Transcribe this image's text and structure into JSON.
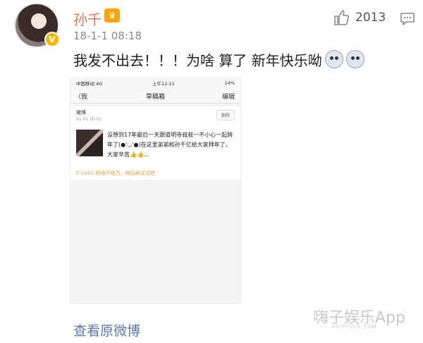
{
  "post": {
    "username": "孙千",
    "vip_label": "♛",
    "verified_badge": "V",
    "time": "18-1-1 08:18",
    "like_count": "2013",
    "text": "我发不出去！！！为啥 算了 新年快乐呦",
    "emoji_names": [
      "husky-emoji",
      "husky-emoji"
    ],
    "view_original": "查看原微博"
  },
  "screenshot": {
    "carrier": "中国移动  4G",
    "clock": "上午12:11",
    "battery": "14%",
    "back_label": "〈我",
    "title": "草稿箱",
    "edit_label": "编辑",
    "draft": {
      "source": "微博",
      "date": "01-01 00:01",
      "delete_label": "删除",
      "text": "没想到17年最后一天跟道明寺叔叔一不小心一起跨年了(●'◡'●)在这里弟弟和孙千亿给大家拜年了，大家辛苦👍👍...",
      "error": "C-1001 网络不给力，稍后再试试吧"
    }
  },
  "watermark": {
    "main": "嗨子娱乐App",
    "sub": "HAIPYULE.COM"
  },
  "colors": {
    "username": "#eb7350",
    "link": "#5c78a8",
    "vip_badge": "#f7a500",
    "error": "#e8a030"
  },
  "icons": [
    "thumbs-up-icon",
    "comment-icon",
    "signal-icon",
    "wifi-icon",
    "battery-icon"
  ]
}
